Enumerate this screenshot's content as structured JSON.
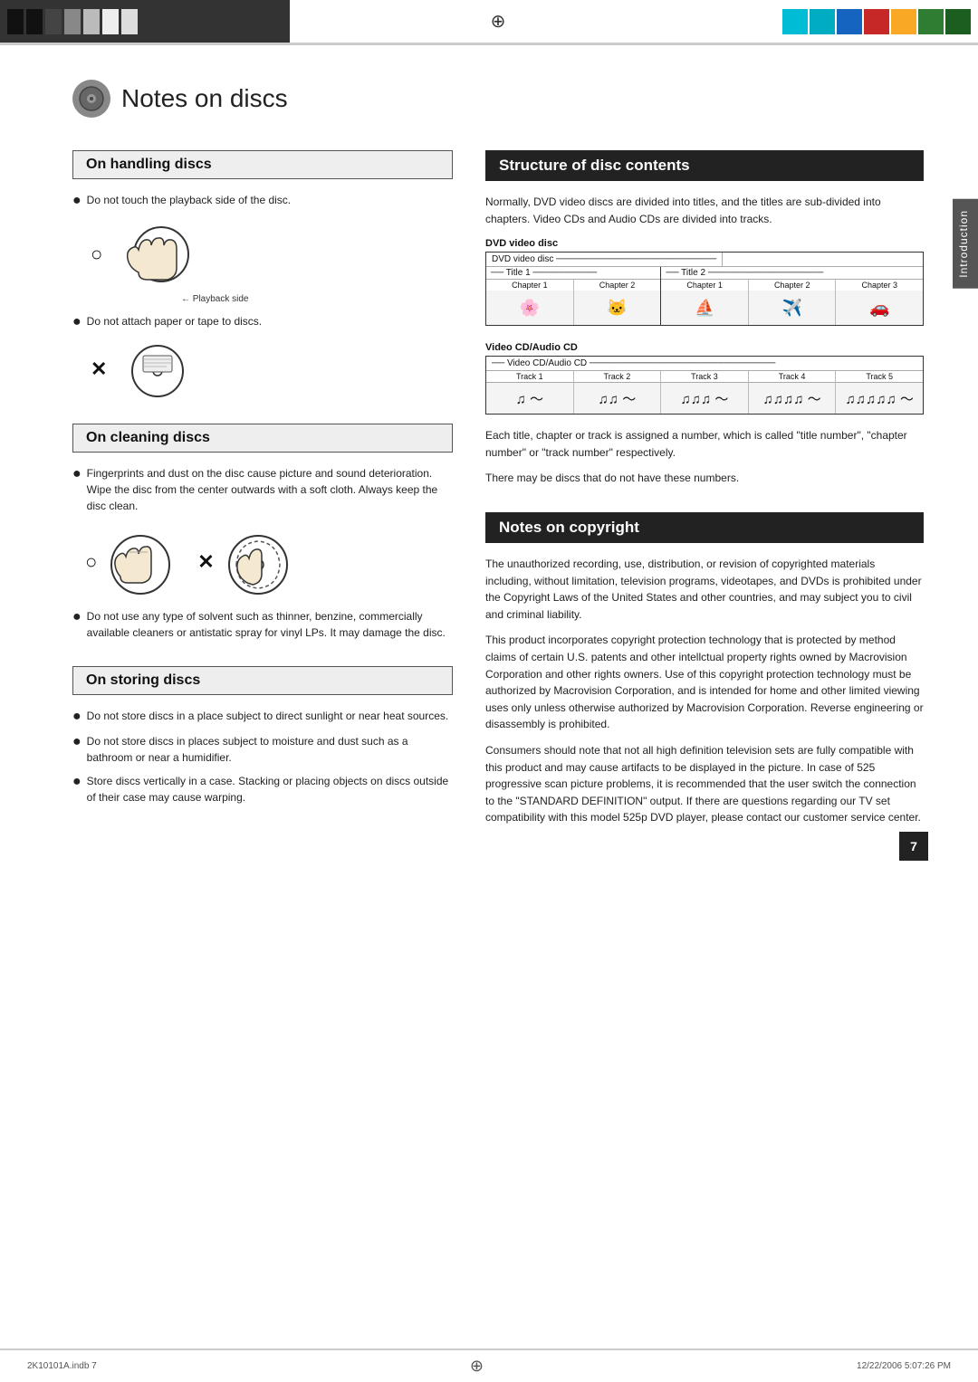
{
  "topBar": {
    "colorBlocks": [
      "black",
      "darkgray",
      "gray",
      "lightgray",
      "white"
    ],
    "swatches": [
      "cyan",
      "blue",
      "red",
      "yellow",
      "green"
    ]
  },
  "pageTitle": "Notes on discs",
  "sections": {
    "handling": {
      "heading": "On handling discs",
      "bullet1": "Do not touch the playback side of the disc.",
      "playbackLabel": "Playback side",
      "bullet2": "Do not attach paper or tape to discs."
    },
    "cleaning": {
      "heading": "On cleaning discs",
      "bullet1": "Fingerprints and dust on the disc cause picture and sound deterioration. Wipe the disc from the center outwards with a soft cloth. Always keep the disc clean.",
      "bullet2": "Do not use any type of solvent such as thinner, benzine, commercially available cleaners or antistatic spray for vinyl LPs. It may damage the disc."
    },
    "storing": {
      "heading": "On storing discs",
      "bullet1": "Do not store discs in a place subject to direct sunlight or near heat sources.",
      "bullet2": "Do not store discs in places subject to moisture and dust such as a bathroom or near a humidifier.",
      "bullet3": "Store discs vertically in a case. Stacking or placing objects on discs outside of their case may cause warping."
    },
    "structure": {
      "heading": "Structure of disc contents",
      "intro": "Normally, DVD video discs are divided into titles, and the titles are sub-divided into chapters. Video CDs and Audio CDs are divided into tracks.",
      "dvdLabel": "DVD video disc",
      "title1": "Title 1",
      "title2": "Title 2",
      "chapters": [
        "Chapter 1",
        "Chapter 2",
        "Chapter 1",
        "Chapter 2",
        "Chapter 3"
      ],
      "videoCDLabel": "Video CD/Audio CD",
      "tracks": [
        "Track 1",
        "Track 2",
        "Track 3",
        "Track 4",
        "Track 5"
      ],
      "caption1": "Each title, chapter or track is assigned a number, which is called \"title number\", \"chapter number\" or \"track number\" respectively.",
      "caption2": "There may be discs that do not have these numbers."
    },
    "copyright": {
      "heading": "Notes on copyright",
      "para1": "The unauthorized recording, use, distribution, or revision of copyrighted materials including, without limitation, television programs, videotapes, and DVDs is prohibited under the Copyright Laws of the United States and other countries, and may subject you to civil and criminal liability.",
      "para2": "This product incorporates copyright protection technology that is protected by method claims of certain U.S. patents and other intellctual property rights owned by Macrovision Corporation and other rights owners. Use of this copyright protection technology must be authorized by Macrovision Corporation, and is intended for home and other limited viewing uses only unless otherwise authorized by Macrovision Corporation. Reverse engineering or disassembly is prohibited.",
      "para3": "Consumers should note that not all high definition television sets are fully compatible with this product and  may cause artifacts to be displayed in the picture. In case of 525 progressive scan picture problems, it is recommended that the user switch the connection to the \"STANDARD DEFINITION\" output. If there are questions regarding our TV set compatibility with this model 525p DVD player, please contact our customer service center."
    }
  },
  "sidebar": {
    "label": "Introduction"
  },
  "footer": {
    "left": "2K10101A.indb  7",
    "right": "12/22/2006  5:07:26 PM"
  },
  "pageNumber": "7"
}
